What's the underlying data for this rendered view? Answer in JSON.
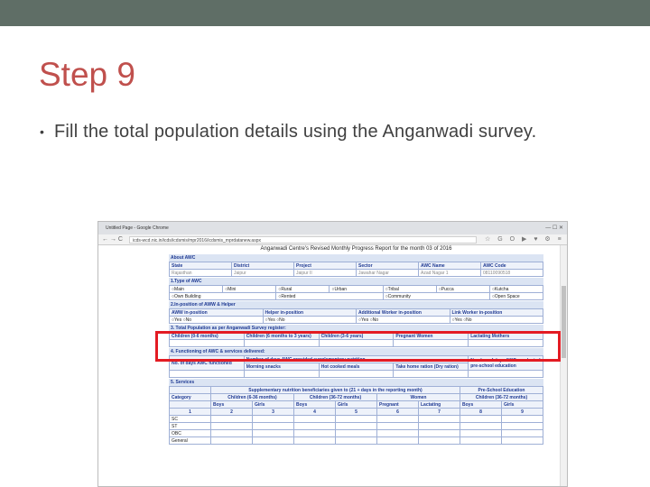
{
  "slide": {
    "title": "Step 9",
    "bullet_marker": "•",
    "bullet_text": "Fill the total population details using the Anganwadi survey.",
    "accent_color": "#c0504d",
    "highlight_color": "#e31b23"
  },
  "browser": {
    "tab_title": "Untitled Page - Google Chrome",
    "window_buttons": "— ☐ ✕",
    "nav_icons": "← → C",
    "url": "icds-wcd.nic.in/icds/icdsmis/mpr2016/icdsmis_mprdatanew.aspx",
    "extension_icons": "☆ G O ▶ ♥ ⚙ ≡"
  },
  "form": {
    "report_title": "Anganwadi Centre's Revised Monthly Progress Report for the month 03 of 2016",
    "about": {
      "heading": "About AWC",
      "headers": [
        "State",
        "District",
        "Project",
        "Sector",
        "AWC Name",
        "AWC Code"
      ],
      "values": [
        "Rajasthan",
        "Jaipur",
        "Jaipur II",
        "Jawahar Nagar",
        "Azad Nagar 1",
        "08110090518"
      ]
    },
    "type": {
      "heading": "1.Type of AWC",
      "row1": [
        "Main",
        "Mini",
        "Rural",
        "Urban",
        "Tribal",
        "Pucca",
        "Kutcha"
      ],
      "row2": [
        "Own Building",
        "Rented",
        "Community",
        "Open Space"
      ]
    },
    "position": {
      "heading": "2.In-position of AWW & Helper",
      "headers": [
        "AWW in-position",
        "Helper in-position",
        "Additional Worker in-position",
        "Link Worker in-position"
      ],
      "yes": "Yes",
      "no": "No"
    },
    "population": {
      "heading": "3. Total Population as per Anganwadi Survey register:",
      "headers": [
        "Children (0-6 months)",
        "Children  (6 months to 3 years)",
        "Children (3-6 years)",
        "Pregnant Women",
        "Lactating Mothers"
      ]
    },
    "functioning": {
      "heading": "4. Functioning of AWC & services delivered:",
      "no_of_days": "No. of days AWC functioned",
      "supp_nutrition": "Number of days AWC provided supplementary nutrition",
      "morning_snacks": "Morning snacks",
      "hot_cooked": "Hot cooked meals",
      "thr": "Take home ration (Dry ration)",
      "pse": "Number of days AWC conducted pre-school education"
    },
    "services": {
      "heading": "5. Services",
      "snp_header": "Supplementary nutrition beneficiaries given to (21 + days in the reporting month)",
      "pse_header": "Pre-School Education",
      "category": "Category",
      "groups": [
        "Children (6-36 months)",
        "Children (36-72 months)",
        "Women",
        "Children (36-72 months)"
      ],
      "subheaders": [
        "Boys",
        "Girls",
        "Boys",
        "Girls",
        "Pregnant",
        "Lactating",
        "Boys",
        "Girls"
      ],
      "col_numbers": [
        "1",
        "2",
        "3",
        "4",
        "5",
        "6",
        "7",
        "8",
        "9"
      ],
      "rows": [
        "SC",
        "ST",
        "OBC",
        "General"
      ]
    }
  }
}
